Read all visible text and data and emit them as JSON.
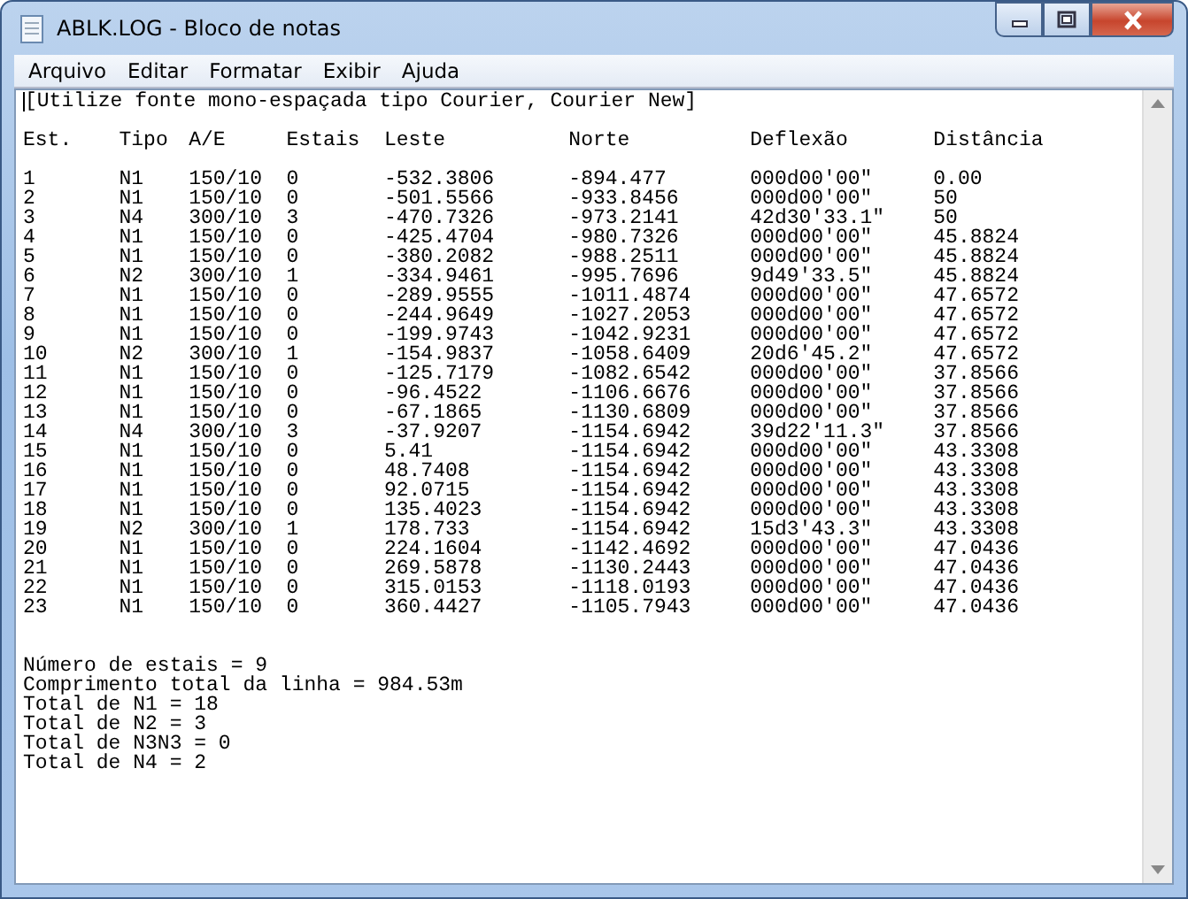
{
  "window": {
    "title": "ABLK.LOG - Bloco de notas"
  },
  "menu": [
    "Arquivo",
    "Editar",
    "Formatar",
    "Exibir",
    "Ajuda"
  ],
  "note": "[Utilize fonte mono-espaçada tipo Courier, Courier New]",
  "table": {
    "columns": [
      "Est.",
      "Tipo",
      "A/E",
      "Estais",
      "Leste",
      "Norte",
      "Deflexão",
      "Distância"
    ],
    "rows": [
      [
        "1",
        "N1",
        "150/10",
        "0",
        "-532.3806",
        "-894.477",
        "000d00'00\"",
        "0.00"
      ],
      [
        "2",
        "N1",
        "150/10",
        "0",
        "-501.5566",
        "-933.8456",
        "000d00'00\"",
        "50"
      ],
      [
        "3",
        "N4",
        "300/10",
        "3",
        "-470.7326",
        "-973.2141",
        "42d30'33.1\"",
        "50"
      ],
      [
        "4",
        "N1",
        "150/10",
        "0",
        "-425.4704",
        "-980.7326",
        "000d00'00\"",
        "45.8824"
      ],
      [
        "5",
        "N1",
        "150/10",
        "0",
        "-380.2082",
        "-988.2511",
        "000d00'00\"",
        "45.8824"
      ],
      [
        "6",
        "N2",
        "300/10",
        "1",
        "-334.9461",
        "-995.7696",
        "9d49'33.5\"",
        "45.8824"
      ],
      [
        "7",
        "N1",
        "150/10",
        "0",
        "-289.9555",
        "-1011.4874",
        "000d00'00\"",
        "47.6572"
      ],
      [
        "8",
        "N1",
        "150/10",
        "0",
        "-244.9649",
        "-1027.2053",
        "000d00'00\"",
        "47.6572"
      ],
      [
        "9",
        "N1",
        "150/10",
        "0",
        "-199.9743",
        "-1042.9231",
        "000d00'00\"",
        "47.6572"
      ],
      [
        "10",
        "N2",
        "300/10",
        "1",
        "-154.9837",
        "-1058.6409",
        "20d6'45.2\"",
        "47.6572"
      ],
      [
        "11",
        "N1",
        "150/10",
        "0",
        "-125.7179",
        "-1082.6542",
        "000d00'00\"",
        "37.8566"
      ],
      [
        "12",
        "N1",
        "150/10",
        "0",
        "-96.4522",
        "-1106.6676",
        "000d00'00\"",
        "37.8566"
      ],
      [
        "13",
        "N1",
        "150/10",
        "0",
        "-67.1865",
        "-1130.6809",
        "000d00'00\"",
        "37.8566"
      ],
      [
        "14",
        "N4",
        "300/10",
        "3",
        "-37.9207",
        "-1154.6942",
        "39d22'11.3\"",
        "37.8566"
      ],
      [
        "15",
        "N1",
        "150/10",
        "0",
        "5.41",
        "-1154.6942",
        "000d00'00\"",
        "43.3308"
      ],
      [
        "16",
        "N1",
        "150/10",
        "0",
        "48.7408",
        "-1154.6942",
        "000d00'00\"",
        "43.3308"
      ],
      [
        "17",
        "N1",
        "150/10",
        "0",
        "92.0715",
        "-1154.6942",
        "000d00'00\"",
        "43.3308"
      ],
      [
        "18",
        "N1",
        "150/10",
        "0",
        "135.4023",
        "-1154.6942",
        "000d00'00\"",
        "43.3308"
      ],
      [
        "19",
        "N2",
        "300/10",
        "1",
        "178.733",
        "-1154.6942",
        "15d3'43.3\"",
        "43.3308"
      ],
      [
        "20",
        "N1",
        "150/10",
        "0",
        "224.1604",
        "-1142.4692",
        "000d00'00\"",
        "47.0436"
      ],
      [
        "21",
        "N1",
        "150/10",
        "0",
        "269.5878",
        "-1130.2443",
        "000d00'00\"",
        "47.0436"
      ],
      [
        "22",
        "N1",
        "150/10",
        "0",
        "315.0153",
        "-1118.0193",
        "000d00'00\"",
        "47.0436"
      ],
      [
        "23",
        "N1",
        "150/10",
        "0",
        "360.4427",
        "-1105.7943",
        "000d00'00\"",
        "47.0436"
      ]
    ]
  },
  "summary": [
    "Número de estais = 9",
    "Comprimento total da linha = 984.53m",
    "Total de N1 = 18",
    "Total de N2 = 3",
    "Total de N3N3 = 0",
    "Total de N4 = 2"
  ]
}
